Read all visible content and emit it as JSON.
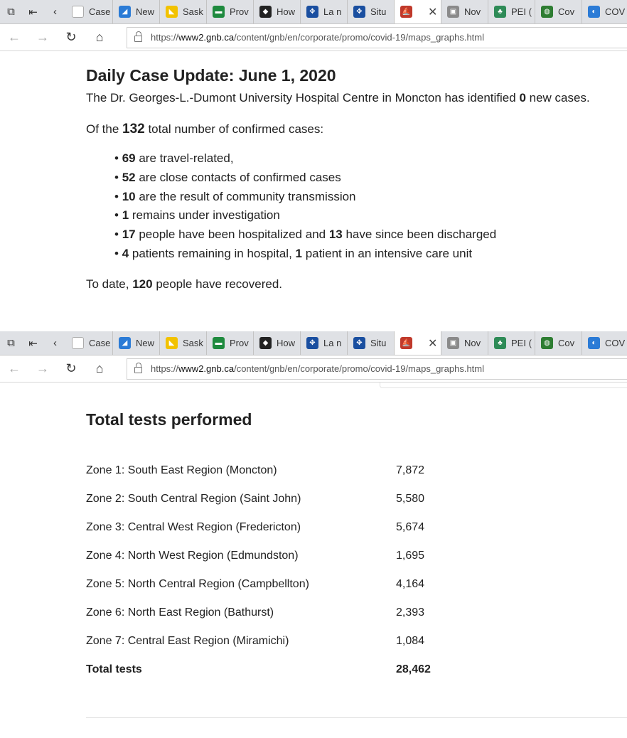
{
  "browser": {
    "tabs": [
      {
        "label": "Case",
        "fav_color": "#ffffff",
        "fav_char": ""
      },
      {
        "label": "New",
        "fav_color": "#2b7bd6",
        "fav_char": "◢"
      },
      {
        "label": "Sask",
        "fav_color": "#f2c200",
        "fav_char": "◣"
      },
      {
        "label": "Prov",
        "fav_color": "#1e8a3e",
        "fav_char": "▬"
      },
      {
        "label": "How",
        "fav_color": "#222222",
        "fav_char": "◆"
      },
      {
        "label": "La n",
        "fav_color": "#1a4fa0",
        "fav_char": "✥"
      },
      {
        "label": "Situ",
        "fav_color": "#1a4fa0",
        "fav_char": "✥"
      },
      {
        "label": "",
        "fav_color": "#c0392b",
        "fav_char": "⛵",
        "active": true
      },
      {
        "label": "Nov",
        "fav_color": "#8a8a8a",
        "fav_char": "▣"
      },
      {
        "label": "PEI (",
        "fav_color": "#2e8b57",
        "fav_char": "♣"
      },
      {
        "label": "Cov",
        "fav_color": "#2e7d32",
        "fav_char": "◍"
      },
      {
        "label": "COV",
        "fav_color": "#2b7bd6",
        "fav_char": "◐"
      }
    ],
    "url_prefix": "https://",
    "url_host": "www2.gnb.ca",
    "url_path": "/content/gnb/en/corporate/promo/covid-19/maps_graphs.html"
  },
  "update": {
    "title": "Daily Case Update: June 1, 2020",
    "hospital_pre": "The Dr. Georges-L.-Dumont University Hospital Centre in Moncton has identified ",
    "hospital_num": "0",
    "hospital_post": " new cases.",
    "total_pre": "Of the ",
    "total_num": "132",
    "total_post": " total number of confirmed cases:",
    "facts": [
      {
        "n1": "69",
        "t1": " are travel-related,",
        "n2": "",
        "t2": ""
      },
      {
        "n1": "52",
        "t1": " are close contacts of confirmed cases",
        "n2": "",
        "t2": ""
      },
      {
        "n1": "10",
        "t1": " are the result of community transmission",
        "n2": "",
        "t2": ""
      },
      {
        "n1": "1",
        "t1": " remains under investigation",
        "n2": "",
        "t2": ""
      },
      {
        "n1": "17",
        "t1": " people have been hospitalized and ",
        "n2": "13",
        "t2": " have since been discharged"
      },
      {
        "n1": "4",
        "t1": " patients remaining in hospital, ",
        "n2": "1",
        "t2": " patient in an intensive care unit"
      }
    ],
    "recovered_pre": "To date, ",
    "recovered_num": "120",
    "recovered_post": " people have recovered."
  },
  "tests": {
    "title": "Total tests performed",
    "rows": [
      {
        "zone": "Zone 1: South East Region (Moncton)",
        "value": "7,872"
      },
      {
        "zone": "Zone 2: South Central Region (Saint John)",
        "value": "5,580"
      },
      {
        "zone": "Zone 3: Central West Region (Fredericton)",
        "value": "5,674"
      },
      {
        "zone": "Zone 4: North West Region (Edmundston)",
        "value": "1,695"
      },
      {
        "zone": "Zone 5: North Central Region (Campbellton)",
        "value": "4,164"
      },
      {
        "zone": "Zone 6: North East Region (Bathurst)",
        "value": "2,393"
      },
      {
        "zone": "Zone 7: Central East Region (Miramichi)",
        "value": "1,084"
      }
    ],
    "total_label": "Total tests",
    "total_value": "28,462"
  }
}
